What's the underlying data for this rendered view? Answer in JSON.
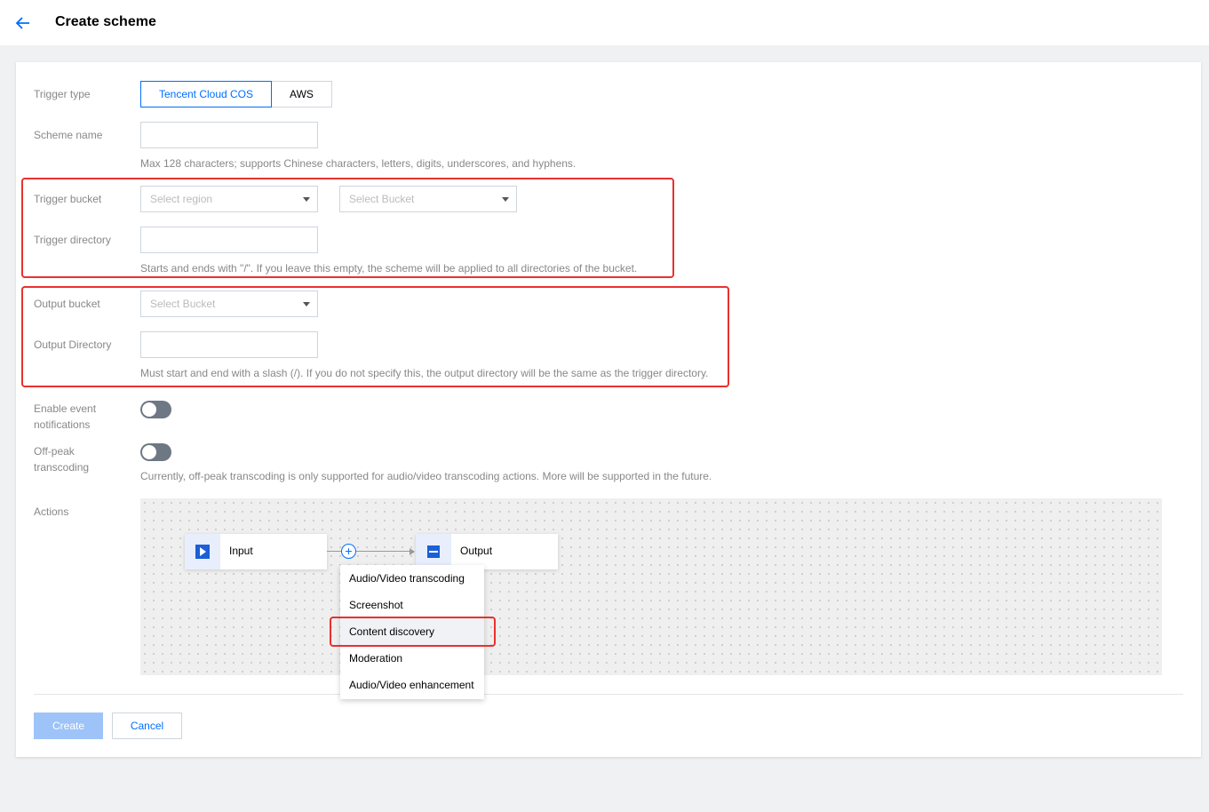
{
  "header": {
    "title": "Create scheme"
  },
  "form": {
    "trigger_type": {
      "label": "Trigger type",
      "options": [
        "Tencent Cloud COS",
        "AWS"
      ],
      "selected": "Tencent Cloud COS"
    },
    "scheme_name": {
      "label": "Scheme name",
      "value": "",
      "hint": "Max 128 characters; supports Chinese characters, letters, digits, underscores, and hyphens."
    },
    "trigger_bucket": {
      "label": "Trigger bucket",
      "region_placeholder": "Select region",
      "bucket_placeholder": "Select Bucket"
    },
    "trigger_directory": {
      "label": "Trigger directory",
      "value": "",
      "hint": "Starts and ends with \"/\". If you leave this empty, the scheme will be applied to all directories of the bucket."
    },
    "output_bucket": {
      "label": "Output bucket",
      "bucket_placeholder": "Select Bucket"
    },
    "output_directory": {
      "label": "Output Directory",
      "value": "",
      "hint": "Must start and end with a slash (/). If you do not specify this, the output directory will be the same as the trigger directory."
    },
    "event_notifications": {
      "label_line1": "Enable event",
      "label_line2": "notifications",
      "enabled": false
    },
    "offpeak": {
      "label_line1": "Off-peak",
      "label_line2": "transcoding",
      "enabled": false,
      "hint": "Currently, off-peak transcoding is only supported for audio/video transcoding actions. More will be supported in the future."
    },
    "actions": {
      "label": "Actions",
      "input_node": "Input",
      "output_node": "Output",
      "menu": [
        "Audio/Video transcoding",
        "Screenshot",
        "Content discovery",
        "Moderation",
        "Audio/Video enhancement"
      ],
      "hovered": "Content discovery"
    }
  },
  "footer": {
    "create_label": "Create",
    "cancel_label": "Cancel"
  },
  "colors": {
    "accent": "#006eff",
    "highlight": "#e8312f",
    "disabled_button": "#9dc3f8"
  },
  "icons": [
    "back-arrow-icon",
    "dropdown-caret-icon",
    "play-icon",
    "output-icon",
    "plus-icon"
  ]
}
